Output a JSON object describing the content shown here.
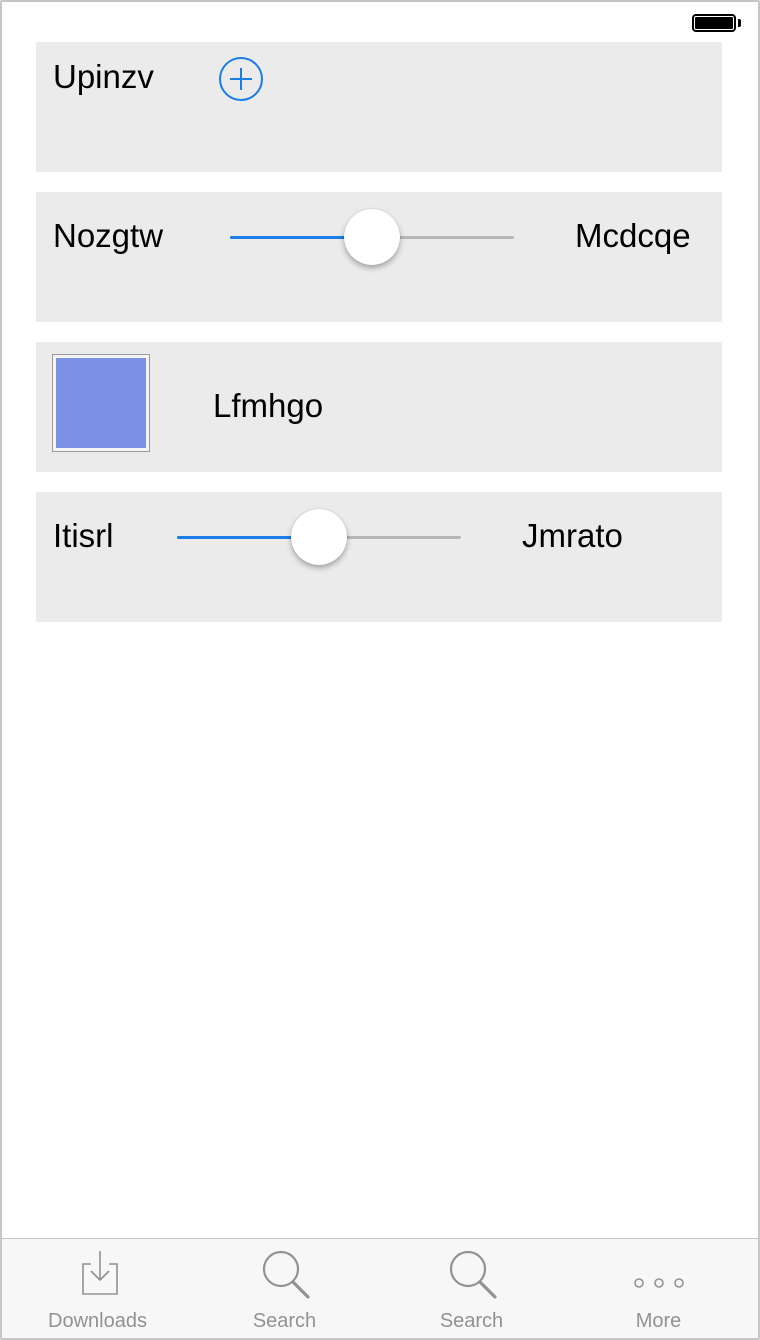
{
  "status_bar": {
    "battery_icon": "battery-full-icon"
  },
  "rows": [
    {
      "label": "Upinzv",
      "control": "add-button",
      "icon": "plus-circle-icon",
      "accent": "#1a7de8"
    },
    {
      "label": "Nozgtw",
      "right_label": "Mcdcqe",
      "control": "slider",
      "value": 0.5
    },
    {
      "label": "Lfmhgo",
      "control": "color-swatch",
      "swatch_color": "#7a91e6"
    },
    {
      "label": "Itisrl",
      "right_label": "Jmrato",
      "control": "slider",
      "value": 0.5
    }
  ],
  "tabbar": {
    "items": [
      {
        "label": "Downloads",
        "icon": "download-icon"
      },
      {
        "label": "Search",
        "icon": "search-icon"
      },
      {
        "label": "Search",
        "icon": "search-icon"
      },
      {
        "label": "More",
        "icon": "more-icon"
      }
    ]
  },
  "colors": {
    "accent": "#1a7de8",
    "row_background": "#ebebeb",
    "tab_label": "#929292"
  }
}
